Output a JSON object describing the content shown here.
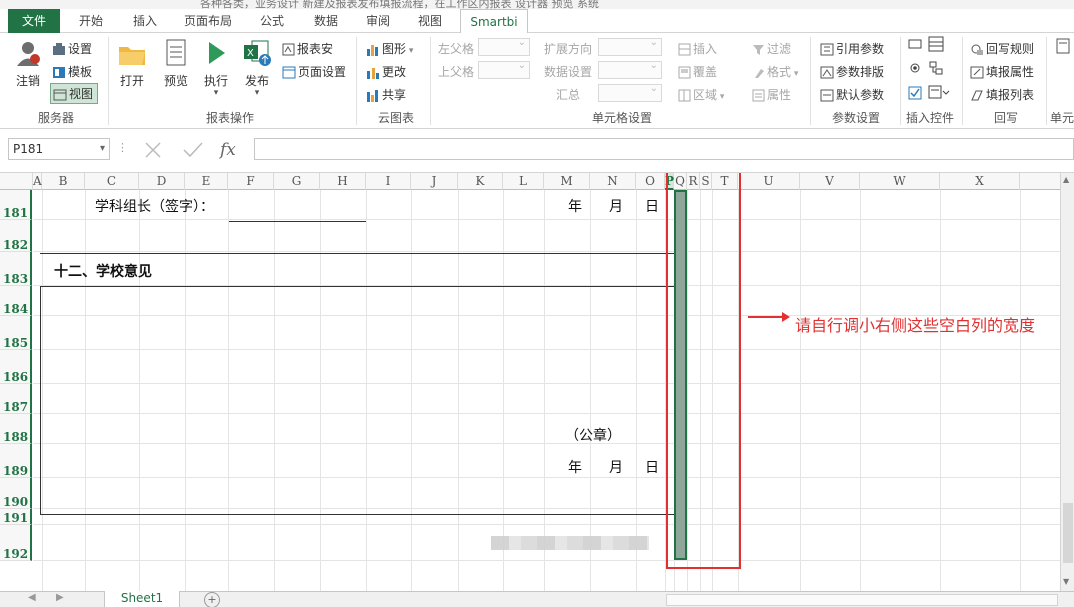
{
  "title_strip": "各种各类，业务设计 新建及报表发布填报流程，在工作区内报表 设计器 预览 系统",
  "tabs": [
    {
      "label": "文件"
    },
    {
      "label": "开始"
    },
    {
      "label": "插入"
    },
    {
      "label": "页面布局"
    },
    {
      "label": "公式"
    },
    {
      "label": "数据"
    },
    {
      "label": "审阅"
    },
    {
      "label": "视图"
    },
    {
      "label": "Smartbi"
    }
  ],
  "ribbon": {
    "server": {
      "label": "服务器",
      "logout": "注销",
      "settings": "设置",
      "template": "模板",
      "view": "视图"
    },
    "report_ops": {
      "label": "报表操作",
      "open": "打开",
      "preview": "预览",
      "execute": "执行",
      "publish": "发布",
      "report_save": "报表安",
      "page_setup": "页面设置"
    },
    "cloud_chart": {
      "label": "云图表",
      "chart": "图形",
      "change": "更改",
      "share": "共享"
    },
    "cell_settings": {
      "label": "单元格设置",
      "left_parent": "左父格",
      "upper_parent": "上父格",
      "expand_dir": "扩展方向",
      "data_settings": "数据设置",
      "summary": "汇总",
      "insert": "插入",
      "cover": "覆盖",
      "area": "区域",
      "filter": "过滤",
      "format": "格式",
      "property": "属性"
    },
    "param_settings": {
      "label": "参数设置",
      "ref_param": "引用参数",
      "param_layout": "参数排版",
      "default_param": "默认参数"
    },
    "insert_ctrl": {
      "label": "插入控件"
    },
    "writeback": {
      "label": "回写",
      "rules": "回写规则",
      "fill_props": "填报属性",
      "fill_list": "填报列表"
    },
    "cell_more": {
      "label": "单元"
    }
  },
  "formula_bar": {
    "name_box": "P181",
    "formula": ""
  },
  "columns": [
    "A",
    "B",
    "C",
    "D",
    "E",
    "F",
    "G",
    "H",
    "I",
    "J",
    "K",
    "L",
    "M",
    "N",
    "O",
    "P",
    "Q",
    "R",
    "S",
    "T",
    "U",
    "V",
    "W",
    "X"
  ],
  "selected_column": "P",
  "rows": [
    "181",
    "182",
    "183",
    "184",
    "185",
    "186",
    "187",
    "188",
    "189",
    "190",
    "191",
    "192"
  ],
  "cells": {
    "subject_leader": "学科组长（签字）：",
    "year1": "年",
    "month1": "月",
    "day1": "日",
    "school_opinion": "十二、学校意见",
    "seal": "（公章）",
    "year2": "年",
    "month2": "月",
    "day2": "日"
  },
  "annotation": "请自行调小右侧这些空白列的宽度",
  "sheet_tab": "Sheet1",
  "colors": {
    "accent": "#217346",
    "annotation_red": "#e03030"
  }
}
